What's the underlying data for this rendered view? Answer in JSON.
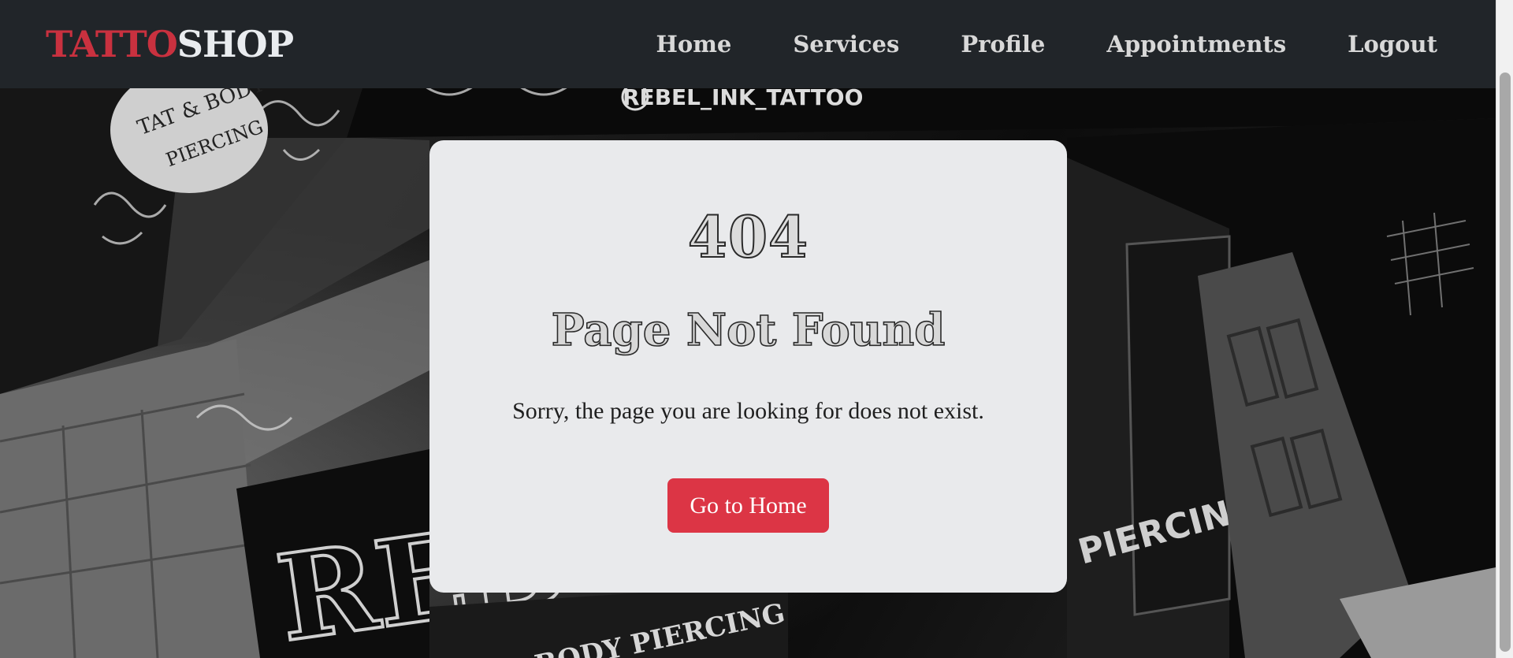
{
  "navbar": {
    "brand_part1": "TATTO",
    "brand_part2": "SHOP",
    "links": [
      {
        "label": "Home"
      },
      {
        "label": "Services"
      },
      {
        "label": "Profile"
      },
      {
        "label": "Appointments"
      },
      {
        "label": "Logout"
      }
    ]
  },
  "background": {
    "sign_texts": [
      "REBEL_INK_TATTOO",
      "TATTOO & BODY PIERCING",
      "& BODY PIERCING",
      "REBEL",
      "PIERCING"
    ]
  },
  "error_card": {
    "code": "404",
    "title": "Page Not Found",
    "message": "Sorry, the page you are looking for does not exist.",
    "button_label": "Go to Home"
  },
  "colors": {
    "navbar_bg": "#212529",
    "brand_red": "#c9313f",
    "brand_light": "#e9ecef",
    "card_bg": "#e9eaec",
    "button_bg": "#dc3545"
  }
}
